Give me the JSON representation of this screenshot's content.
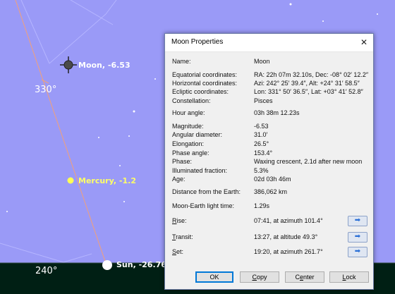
{
  "sky": {
    "background_color": "#9a9af7",
    "ground_color": "#001f14",
    "objects": [
      {
        "name": "moon",
        "label": "Moon, -6.53"
      },
      {
        "name": "mercury",
        "label": "Mercury, -1.2"
      },
      {
        "name": "sun",
        "label": "Sun, -26.76"
      }
    ],
    "azimuth_labels": [
      "330°",
      "240°"
    ]
  },
  "dialog": {
    "title": "Moon Properties",
    "close_glyph": "✕",
    "properties": [
      {
        "label": "Name:",
        "value": "Moon"
      },
      {
        "label": "Equatorial coordinates:",
        "value": "RA: 22h 07m 32.10s, Dec: -08° 02′ 12.2″"
      },
      {
        "label": "Horizontal coordinates:",
        "value": "Azi: 242° 25′ 39.4″, Alt: +24° 31′ 58.5″"
      },
      {
        "label": "Ecliptic coordinates:",
        "value": "Lon: 331° 50′ 36.5″, Lat: +03° 41′ 52.8″"
      },
      {
        "label": "Constellation:",
        "value": "Pisces"
      },
      {
        "label": "Hour angle:",
        "value": "03h 38m 12.23s"
      },
      {
        "label": "Magnitude:",
        "value": "-6.53"
      },
      {
        "label": "Angular diameter:",
        "value": "31.0′"
      },
      {
        "label": "Elongation:",
        "value": "26.5°"
      },
      {
        "label": "Phase angle:",
        "value": "153.4°"
      },
      {
        "label": "Phase:",
        "value": "Waxing crescent, 2.1d after new moon"
      },
      {
        "label": "Illuminated fraction:",
        "value": "5.3%"
      },
      {
        "label": "Age:",
        "value": "02d 03h 46m"
      },
      {
        "label": "Distance from the Earth:",
        "value": "386,062 km"
      },
      {
        "label": "Moon-Earth light time:",
        "value": "1.29s"
      }
    ],
    "events": [
      {
        "key": "R",
        "rest": "ise:",
        "value": "07:41, at azimuth 101.4°",
        "icon": "arrow-right-icon"
      },
      {
        "key": "T",
        "rest": "ransit:",
        "value": "13:27, at altitude 49.3°",
        "icon": "arrow-right-icon"
      },
      {
        "key": "S",
        "rest": "et:",
        "value": "19:20, at azimuth 261.7°",
        "icon": "arrow-right-icon"
      }
    ],
    "buttons": {
      "ok": "OK",
      "copy_key": "C",
      "copy_rest": "opy",
      "center_pre": "C",
      "center_key": "e",
      "center_rest": "nter",
      "lock_key": "L",
      "lock_rest": "ock"
    }
  }
}
